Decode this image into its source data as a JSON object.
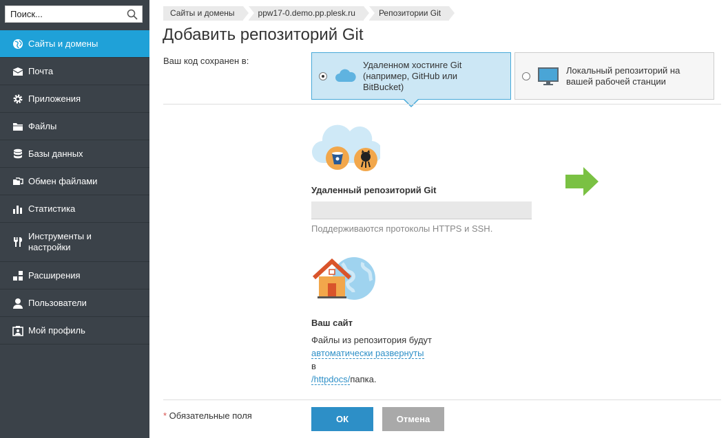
{
  "search": {
    "placeholder": "Поиск..."
  },
  "sidebar": {
    "items": [
      {
        "label": "Сайты и домены",
        "icon": "globe-icon",
        "active": true
      },
      {
        "label": "Почта",
        "icon": "envelope-icon"
      },
      {
        "label": "Приложения",
        "icon": "gear-icon"
      },
      {
        "label": "Файлы",
        "icon": "folder-icon"
      },
      {
        "label": "Базы данных",
        "icon": "database-icon"
      },
      {
        "label": "Обмен файлами",
        "icon": "file-sharing-icon"
      },
      {
        "label": "Статистика",
        "icon": "bar-chart-icon"
      },
      {
        "label": "Инструменты и настройки",
        "icon": "tools-icon"
      },
      {
        "label": "Расширения",
        "icon": "extensions-icon"
      },
      {
        "label": "Пользователи",
        "icon": "user-icon"
      },
      {
        "label": "Мой профиль",
        "icon": "profile-icon"
      }
    ]
  },
  "breadcrumbs": [
    "Сайты и домены",
    "ppw17-0.demo.pp.plesk.ru",
    "Репозитории Git"
  ],
  "page_title": "Добавить репозиторий Git",
  "form": {
    "code_location_label": "Ваш код сохранен в:",
    "options": [
      {
        "label": "Удаленном хостинге Git (например, GitHub или BitBucket)",
        "icon": "cloud-icon",
        "selected": true
      },
      {
        "label": "Локальный репозиторий на вашей рабочей станции",
        "icon": "monitor-icon",
        "selected": false
      }
    ],
    "remote_repo_label": "Удаленный репозиторий Git",
    "remote_repo_value": "",
    "remote_hint": "Поддерживаются протоколы HTTPS и SSH.",
    "site_label": "Ваш сайт",
    "site_desc_1": "Файлы из репозитория будут",
    "site_link_deploy": "автоматически развернуты",
    "site_desc_2": "в",
    "site_link_path": "/httpdocs/",
    "site_desc_3": "папка.",
    "required_star": "*",
    "required_text": " Обязательные поля",
    "ok_label": "ОК",
    "cancel_label": "Отмена"
  },
  "colors": {
    "sidebar_bg": "#3b4249",
    "active_item": "#1fa1d8",
    "selected_option_bg": "#cce7f5",
    "ok_button": "#2d8fc7",
    "cancel_button": "#a9a9a9",
    "link": "#2d8fc7",
    "arrow": "#7ac143"
  }
}
